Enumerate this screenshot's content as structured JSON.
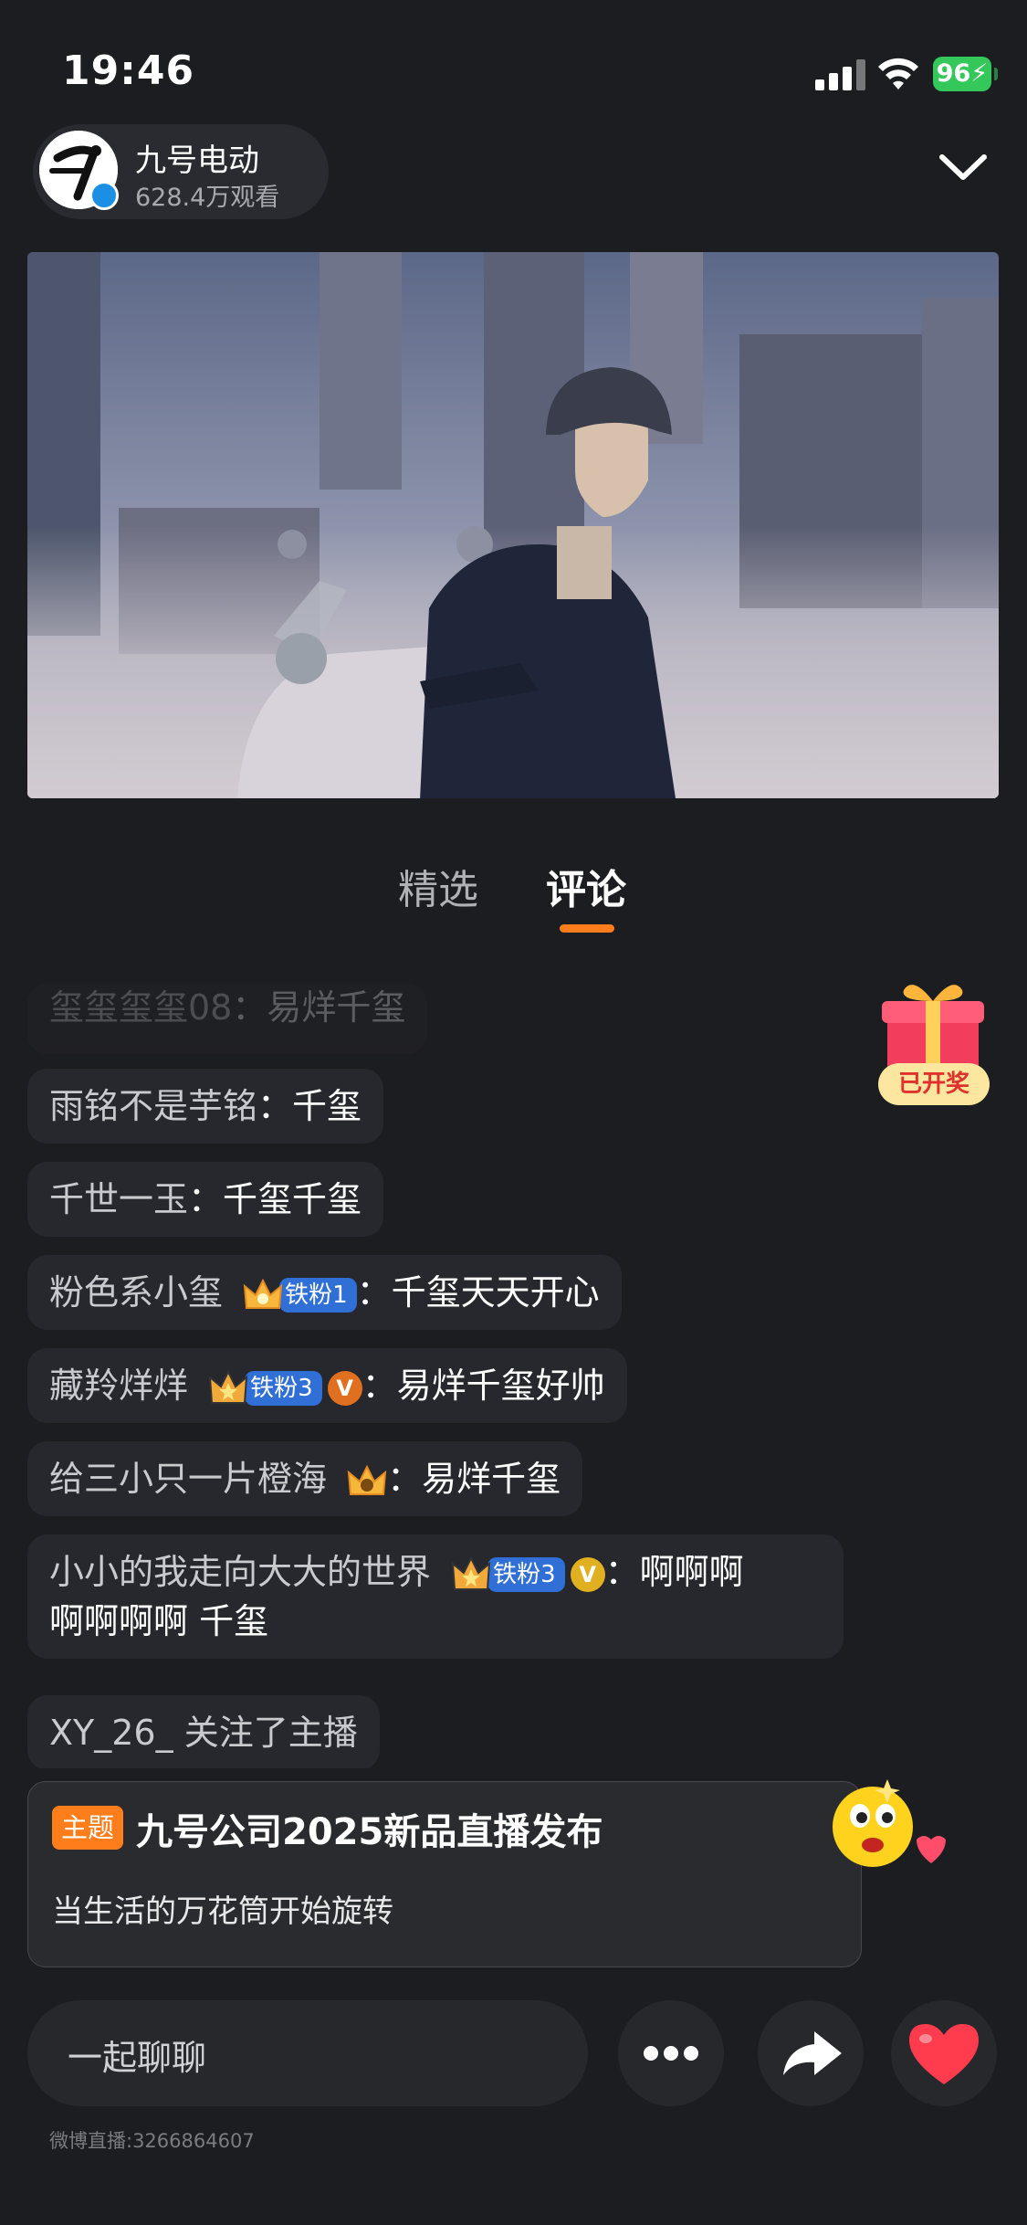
{
  "status_bar": {
    "time": "19:46",
    "battery": "96",
    "icons": [
      "signal-icon",
      "wifi-icon",
      "battery-charging-icon"
    ]
  },
  "host": {
    "name": "九号电动",
    "views": "628.4万观看",
    "verified": true
  },
  "tabs": [
    {
      "label": "精选",
      "active": false
    },
    {
      "label": "评论",
      "active": true
    }
  ],
  "comments": [
    {
      "user": "玺玺玺玺08",
      "sep": "：",
      "text": "易烊千玺",
      "faded": true
    },
    {
      "user": "雨铭不是芋铭",
      "sep": "：",
      "text": "千玺"
    },
    {
      "user": "千世一玉",
      "sep": "：",
      "text": "千玺千玺"
    },
    {
      "user": "粉色系小玺",
      "badge": "铁粉1",
      "sep": "：",
      "text": "千玺天天开心"
    },
    {
      "user": "藏羚烊烊",
      "badge": "铁粉3",
      "vip": "V",
      "sep": "：",
      "text": "易烊千玺好帅"
    },
    {
      "user": "给三小只一片橙海",
      "sep": "：",
      "text": "易烊千玺"
    },
    {
      "user": "小小的我走向大大的世界",
      "badge": "铁粉3",
      "vip": "V",
      "sep": "：",
      "text_line1": "啊啊啊",
      "text_line2": "啊啊啊啊 千玺"
    },
    {
      "user": "XY_26_",
      "text": "关注了主播"
    }
  ],
  "gift": {
    "label": "已开奖"
  },
  "topic": {
    "tag": "主题",
    "title": "九号公司2025新品直播发布",
    "subtitle": "当生活的万花筒开始旋转"
  },
  "bottom_bar": {
    "chat_placeholder": "一起聊聊",
    "buttons": [
      "more-icon",
      "share-icon",
      "heart-icon"
    ]
  },
  "footer": {
    "id_text": "微博直播:3266864607"
  },
  "colors": {
    "background": "#1c1d21",
    "accent": "#ff7d1a",
    "badge_blue": "#2f6fd6",
    "battery_green": "#34c759"
  }
}
